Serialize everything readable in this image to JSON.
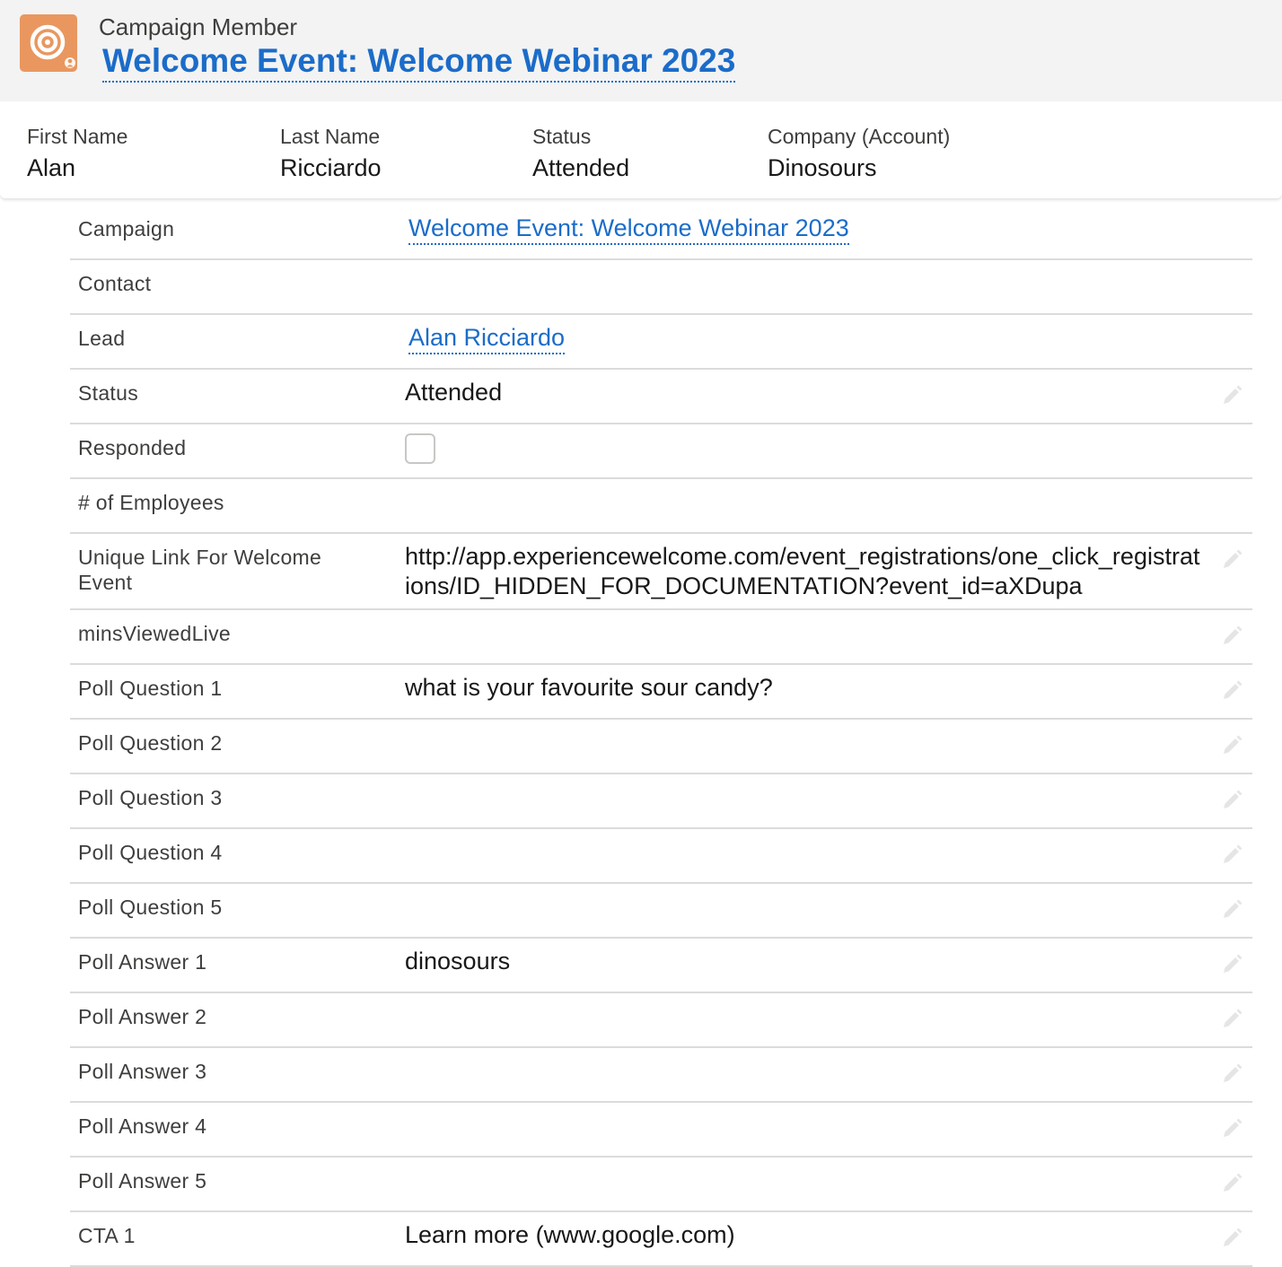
{
  "header": {
    "object_type": "Campaign Member",
    "record_title": "Welcome Event: Welcome Webinar 2023",
    "icon": "campaign-member-target-icon",
    "icon_color": "#e9975f",
    "link_color": "#1b6cc9"
  },
  "highlights": [
    {
      "label": "First Name",
      "value": "Alan"
    },
    {
      "label": "Last Name",
      "value": "Ricciardo"
    },
    {
      "label": "Status",
      "value": "Attended"
    },
    {
      "label": "Company (Account)",
      "value": "Dinosours"
    }
  ],
  "details": {
    "campaign": {
      "label": "Campaign",
      "value": "Welcome Event: Welcome Webinar 2023"
    },
    "contact": {
      "label": "Contact",
      "value": ""
    },
    "lead": {
      "label": "Lead",
      "value": "Alan Ricciardo"
    },
    "status": {
      "label": "Status",
      "value": "Attended"
    },
    "responded": {
      "label": "Responded",
      "checked": false
    },
    "employees": {
      "label": "# of Employees",
      "value": ""
    },
    "unique_link": {
      "label": "Unique Link For Welcome Event",
      "value": "http://app.experiencewelcome.com/event_registrations/one_click_registrations/ID_HIDDEN_FOR_DOCUMENTATION?event_id=aXDupa"
    },
    "mins_viewed": {
      "label": "minsViewedLive",
      "value": ""
    },
    "poll_q1": {
      "label": "Poll Question 1",
      "value": "what is your favourite sour candy?"
    },
    "poll_q2": {
      "label": "Poll Question 2",
      "value": ""
    },
    "poll_q3": {
      "label": "Poll Question 3",
      "value": ""
    },
    "poll_q4": {
      "label": "Poll Question 4",
      "value": ""
    },
    "poll_q5": {
      "label": "Poll Question 5",
      "value": ""
    },
    "poll_a1": {
      "label": "Poll Answer 1",
      "value": "dinosours"
    },
    "poll_a2": {
      "label": "Poll Answer 2",
      "value": ""
    },
    "poll_a3": {
      "label": "Poll Answer 3",
      "value": ""
    },
    "poll_a4": {
      "label": "Poll Answer 4",
      "value": ""
    },
    "poll_a5": {
      "label": "Poll Answer 5",
      "value": ""
    },
    "cta1": {
      "label": "CTA 1",
      "value": "Learn more (www.google.com)"
    }
  },
  "edit_icon": "pencil-edit-icon"
}
